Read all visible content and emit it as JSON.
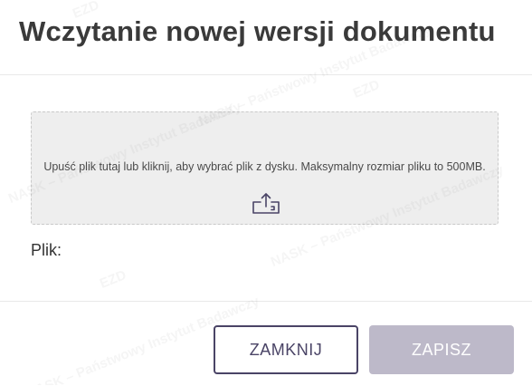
{
  "dialog": {
    "title": "Wczytanie nowej wersji dokumentu",
    "dropzone": {
      "text": "Upuść plik tutaj lub kliknij, aby wybrać plik z dysku. Maksymalny rozmiar pliku to 500MB.",
      "icon": "upload-icon"
    },
    "file_label": "Plik:",
    "buttons": {
      "close_label": "ZAMKNIJ",
      "save_label": "ZAPISZ"
    }
  },
  "watermark": {
    "brand": "EZD",
    "text": "NASK – Państwowy Instytut Badawczy"
  },
  "colors": {
    "primary": "#4a4466",
    "save_disabled": "#bdb9c9",
    "dropzone_bg": "#eeeeee"
  }
}
